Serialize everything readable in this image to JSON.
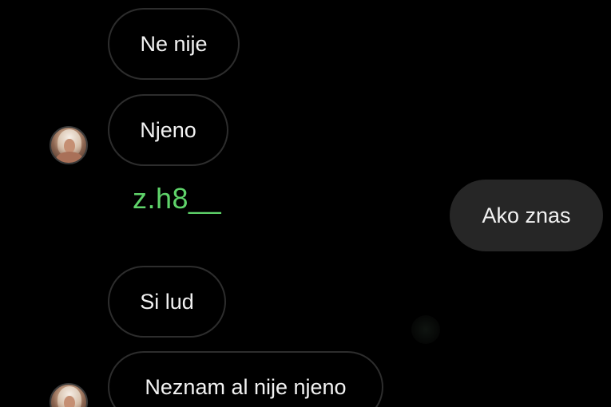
{
  "messages": {
    "msg1": "Ne nije",
    "msg2": "Njeno",
    "mention": "z.h8__",
    "msg3_outgoing": "Ako znas",
    "msg4": "Si lud",
    "msg5": "Neznam al nije njeno"
  },
  "colors": {
    "background": "#000000",
    "incoming_border": "#2d2d2d",
    "outgoing_fill": "#262626",
    "mention_text": "#5fd36a",
    "text": "#f2f2f2"
  }
}
